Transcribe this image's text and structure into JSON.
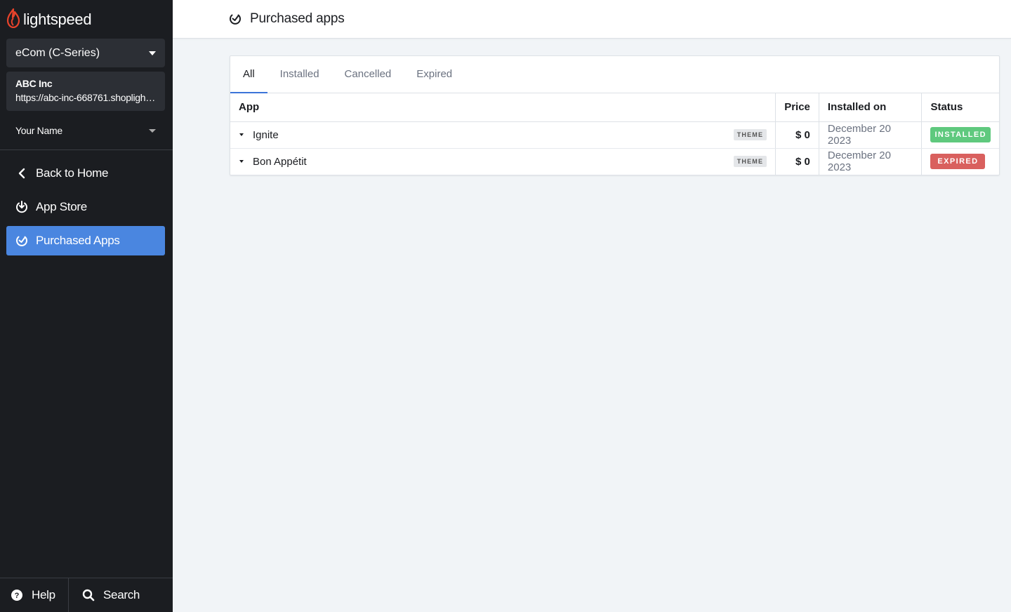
{
  "brand": {
    "name": "lightspeed",
    "logo_icon": "flame-icon",
    "accent": "#e8432b"
  },
  "sidebar": {
    "product_select": "eCom (C-Series)",
    "shop": {
      "name": "ABC Inc",
      "url": "https://abc-inc-668761.shoplightspeed.com"
    },
    "user_name": "Your Name",
    "nav": [
      {
        "label": "Back to Home",
        "icon": "chevron-left-icon",
        "active": false
      },
      {
        "label": "App Store",
        "icon": "download-icon",
        "active": false
      },
      {
        "label": "Purchased Apps",
        "icon": "purchased-icon",
        "active": true
      }
    ],
    "bottom": [
      {
        "label": "Help",
        "icon": "help-icon"
      },
      {
        "label": "Search",
        "icon": "search-icon"
      }
    ]
  },
  "header": {
    "title": "Purchased apps",
    "icon": "purchased-icon"
  },
  "tabs": [
    {
      "label": "All",
      "active": true
    },
    {
      "label": "Installed",
      "active": false
    },
    {
      "label": "Cancelled",
      "active": false
    },
    {
      "label": "Expired",
      "active": false
    }
  ],
  "table": {
    "columns": [
      "App",
      "Price",
      "Installed on",
      "Status"
    ],
    "rows": [
      {
        "app": "Ignite",
        "tag": "THEME",
        "price": "$ 0",
        "installed_on": "December 20 2023",
        "status": "INSTALLED",
        "status_color": "#5fc97e"
      },
      {
        "app": "Bon Appétit",
        "tag": "THEME",
        "price": "$ 0",
        "installed_on": "December 20 2023",
        "status": "EXPIRED",
        "status_color": "#d9605e"
      }
    ]
  },
  "colors": {
    "sidebar_bg": "#1b1d21",
    "active_nav": "#4a86e0",
    "page_bg": "#f1f4f7",
    "tab_underline": "#3b74d8"
  }
}
